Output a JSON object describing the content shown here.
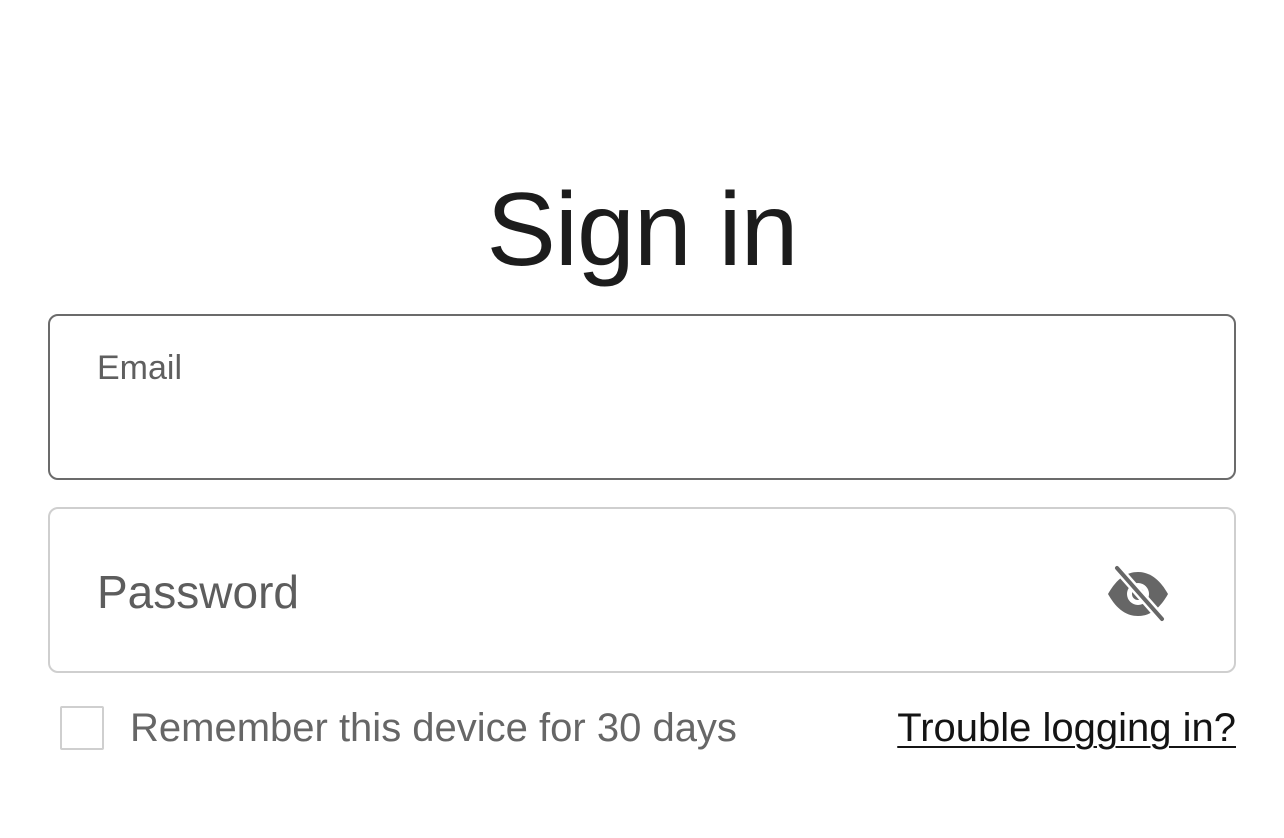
{
  "page": {
    "title": "Sign in"
  },
  "form": {
    "email": {
      "label": "Email",
      "value": ""
    },
    "password": {
      "placeholder": "Password",
      "value": "",
      "toggle_icon": "eye-slash-icon"
    },
    "remember": {
      "label": "Remember this device for 30 days",
      "checked": false
    },
    "trouble_link": "Trouble logging in?"
  },
  "colors": {
    "text": "#1c1c1c",
    "muted_text": "#666666",
    "focused_border": "#6b6b6b",
    "idle_border": "#cfcfcf",
    "icon": "#666666"
  }
}
